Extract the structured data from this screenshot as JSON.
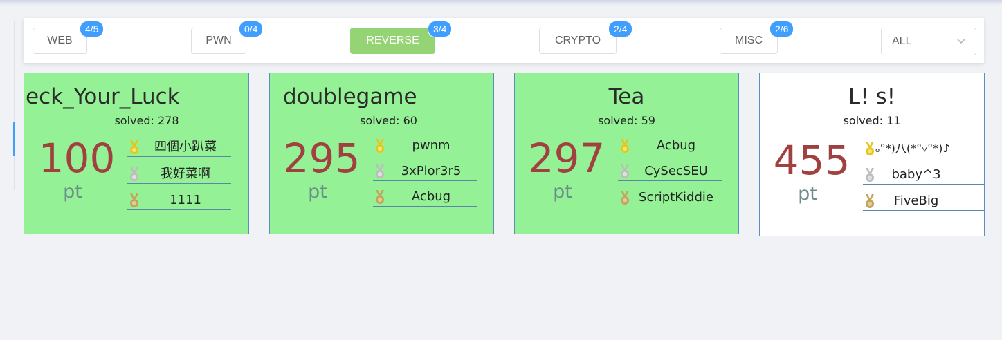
{
  "categories": [
    {
      "label": "WEB",
      "badge": "4/5"
    },
    {
      "label": "PWN",
      "badge": "0/4"
    },
    {
      "label": "REVERSE",
      "badge": "3/4"
    },
    {
      "label": "CRYPTO",
      "badge": "2/4"
    },
    {
      "label": "MISC",
      "badge": "2/6"
    }
  ],
  "active_category": "REVERSE",
  "filter_select": {
    "value": "ALL"
  },
  "challenges": [
    {
      "title": "eck_Your_Luck",
      "solved_text": "solved: 278",
      "points": "100",
      "unit": "pt",
      "status": "solved",
      "solvers": [
        "四個小趴菜",
        "我好菜啊",
        "1111"
      ]
    },
    {
      "title": "doublegame",
      "solved_text": "solved: 60",
      "points": "295",
      "unit": "pt",
      "status": "solved",
      "solvers": [
        "pwnm",
        "3xPlor3r5",
        "Acbug"
      ]
    },
    {
      "title": "Tea",
      "solved_text": "solved: 59",
      "points": "297",
      "unit": "pt",
      "status": "solved",
      "solvers": [
        "Acbug",
        "CySecSEU",
        "ScriptKiddie"
      ]
    },
    {
      "title": "L! s!",
      "solved_text": "solved: 11",
      "points": "455",
      "unit": "pt",
      "status": "unsolved",
      "solvers": [
        "ₒ°*)八(*°▿°*)♪",
        "baby^3",
        "FiveBig"
      ]
    }
  ],
  "colors": {
    "solved_card": "#95f195",
    "unsolved_card": "#ffffff",
    "points": "#a0413f",
    "badge": "#409eff",
    "active_tab": "#95d475",
    "gold_medal": "#e6c619",
    "silver_medal": "#bdbdbd",
    "bronze_medal": "#c4a35a"
  },
  "icons": [
    "gold-medal-icon",
    "silver-medal-icon",
    "bronze-medal-icon",
    "chevron-down-icon"
  ]
}
